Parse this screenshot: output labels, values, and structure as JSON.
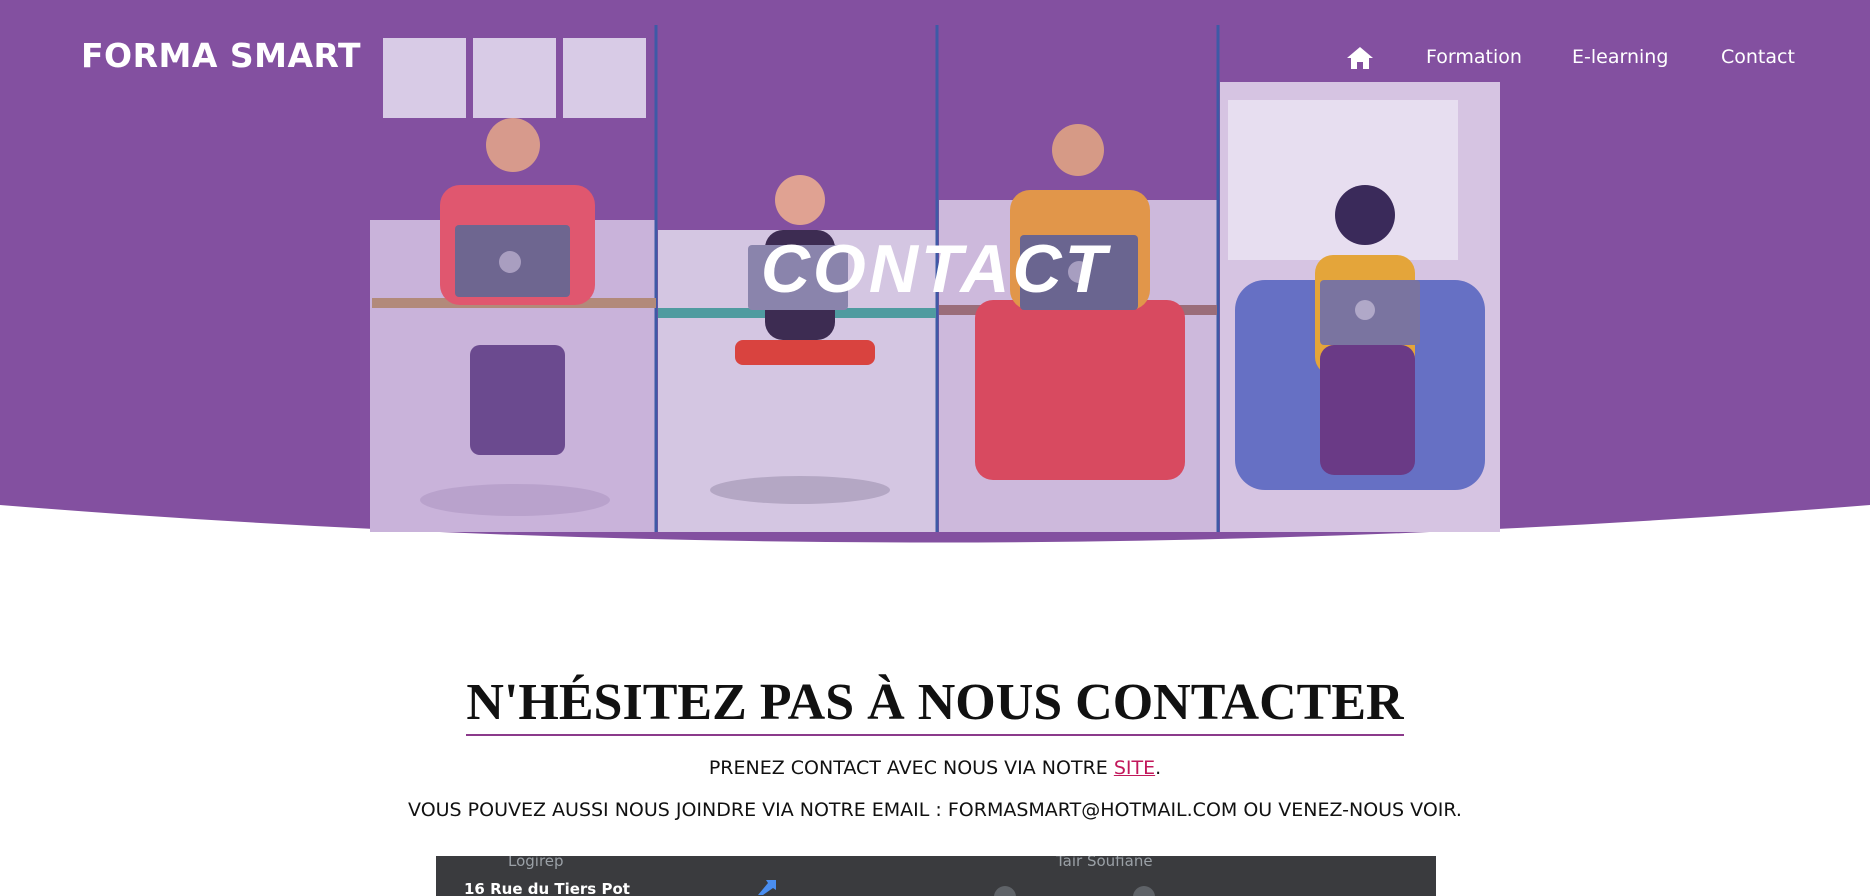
{
  "brand": {
    "name": "FORMA SMART"
  },
  "nav": {
    "home_icon": "home-icon",
    "items": [
      {
        "label": "Formation"
      },
      {
        "label": "E-learning"
      },
      {
        "label": "Contact"
      }
    ]
  },
  "hero": {
    "title": "CONTACT"
  },
  "main": {
    "title": "N'HÉSITEZ PAS À NOUS CONTACTER",
    "line1_prefix": "PRENEZ CONTACT AVEC NOUS VIA NOTRE ",
    "line1_link": "SITE",
    "line1_suffix": ".",
    "line2": "VOUS POUVEZ AUSSI NOUS JOINDRE VIA NOTRE EMAIL : FORMASMART@HOTMAIL.COM OU VENEZ-NOUS VOIR."
  },
  "map": {
    "label_left": "Logirep",
    "label_right": "Tair Soufiane",
    "address": "16 Rue du Tiers Pot",
    "directions_icon": "directions-icon"
  },
  "colors": {
    "hero_purple": "#8350a0",
    "title_underline": "#8b3a8b",
    "link": "#c2185b",
    "map_bg": "#3a3b3e"
  }
}
